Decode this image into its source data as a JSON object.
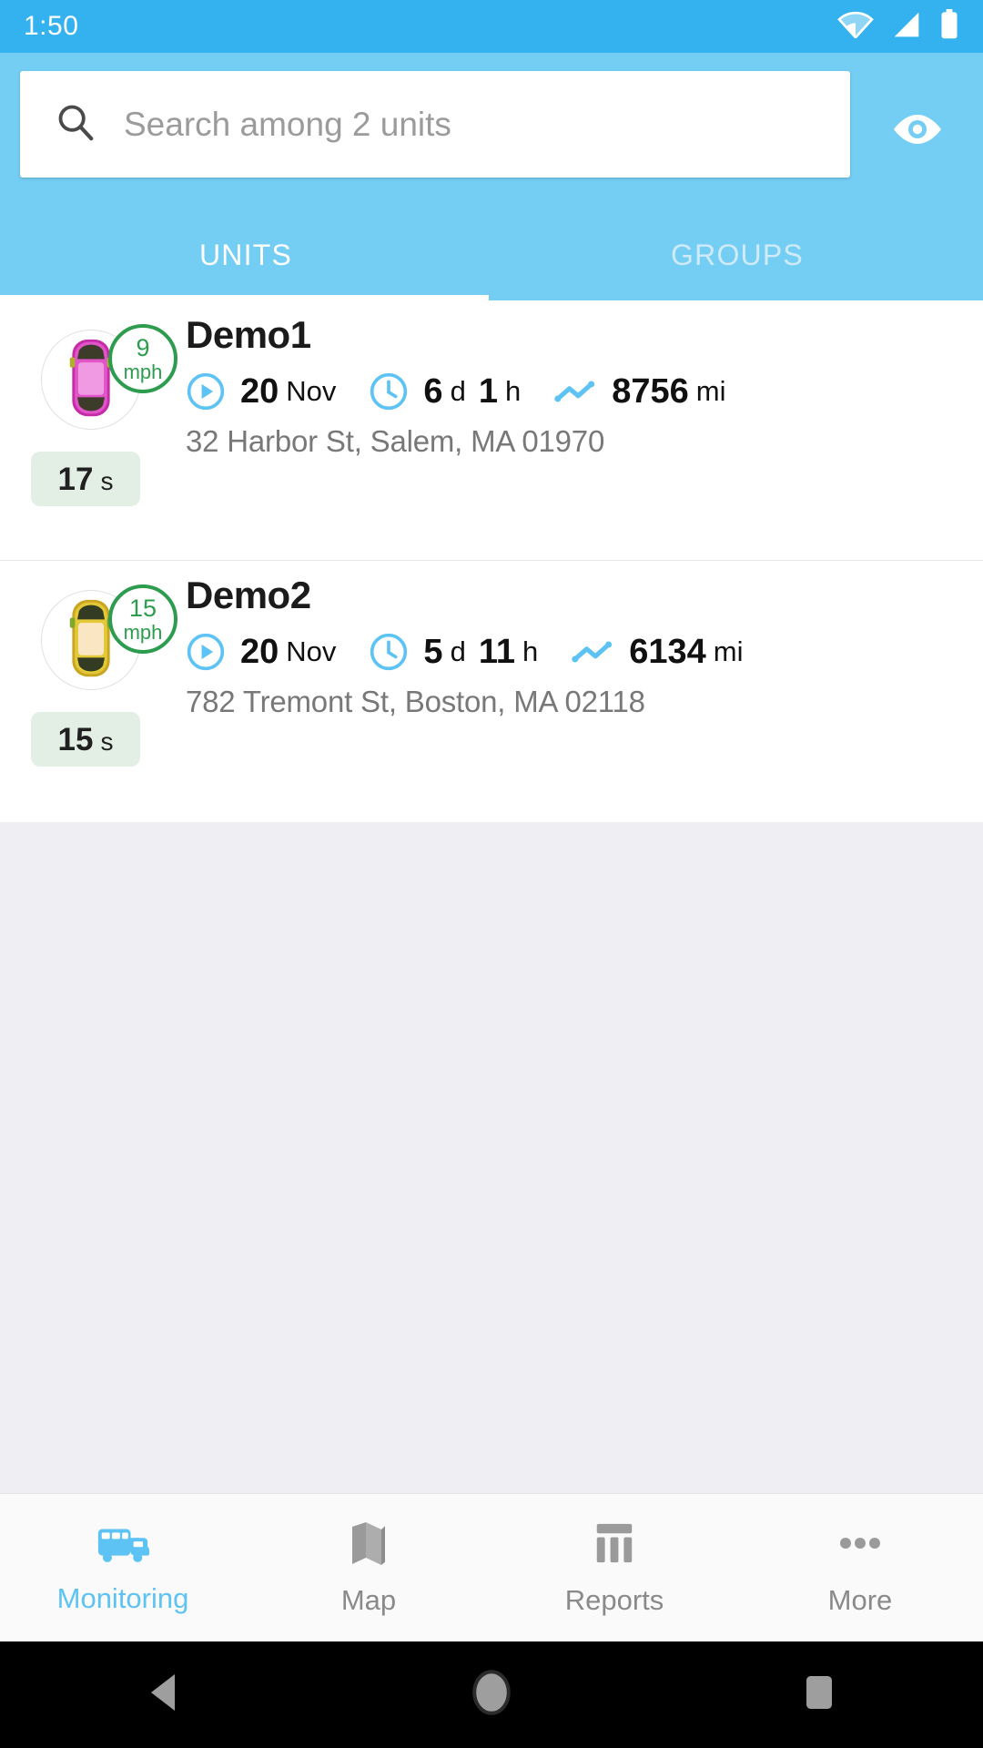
{
  "statusbar": {
    "time": "1:50",
    "icons": [
      "wifi-icon",
      "cellular-signal-icon",
      "battery-icon"
    ]
  },
  "header": {
    "search": {
      "placeholder": "Search among 2 units",
      "value": "",
      "icon": "search-icon"
    },
    "visibility_toggle": {
      "icon": "eye-icon"
    },
    "tabs": [
      {
        "label": "UNITS",
        "active": true
      },
      {
        "label": "GROUPS",
        "active": false
      }
    ]
  },
  "units": [
    {
      "name": "Demo1",
      "vehicle_icon": "car-top-view-icon",
      "vehicle_color": "#d93fc0",
      "speed_value": "9",
      "speed_unit": "mph",
      "idle_value": "17",
      "idle_unit": "s",
      "date_icon": "play-circle-icon",
      "date_value": "20",
      "date_month": "Nov",
      "duration_icon": "clock-icon",
      "duration_days": "6",
      "duration_days_unit": "d",
      "duration_hours": "1",
      "duration_hours_unit": "h",
      "mileage_icon": "trend-line-icon",
      "mileage_value": "8756",
      "mileage_unit": "mi",
      "address": "32 Harbor St, Salem, MA 01970"
    },
    {
      "name": "Demo2",
      "vehicle_icon": "car-top-view-icon",
      "vehicle_color": "#d9b62a",
      "speed_value": "15",
      "speed_unit": "mph",
      "idle_value": "15",
      "idle_unit": "s",
      "date_icon": "play-circle-icon",
      "date_value": "20",
      "date_month": "Nov",
      "duration_icon": "clock-icon",
      "duration_days": "5",
      "duration_days_unit": "d",
      "duration_hours": "11",
      "duration_hours_unit": "h",
      "mileage_icon": "trend-line-icon",
      "mileage_value": "6134",
      "mileage_unit": "mi",
      "address": "782 Tremont St, Boston, MA 02118"
    }
  ],
  "bottom_nav": [
    {
      "label": "Monitoring",
      "icon": "bus-icon",
      "active": true
    },
    {
      "label": "Map",
      "icon": "map-folded-icon",
      "active": false
    },
    {
      "label": "Reports",
      "icon": "bar-chart-icon",
      "active": false
    },
    {
      "label": "More",
      "icon": "ellipsis-icon",
      "active": false
    }
  ],
  "android_nav": [
    {
      "icon": "back-triangle-icon"
    },
    {
      "icon": "home-circle-icon"
    },
    {
      "icon": "recents-square-icon"
    }
  ],
  "colors": {
    "status_bar": "#33b2ef",
    "header": "#74cdf3",
    "accent": "#5dc3f4",
    "speed_badge": "#2d9c4e",
    "idle_pill_bg": "#e3efe4",
    "page_bg": "#efeef2"
  }
}
